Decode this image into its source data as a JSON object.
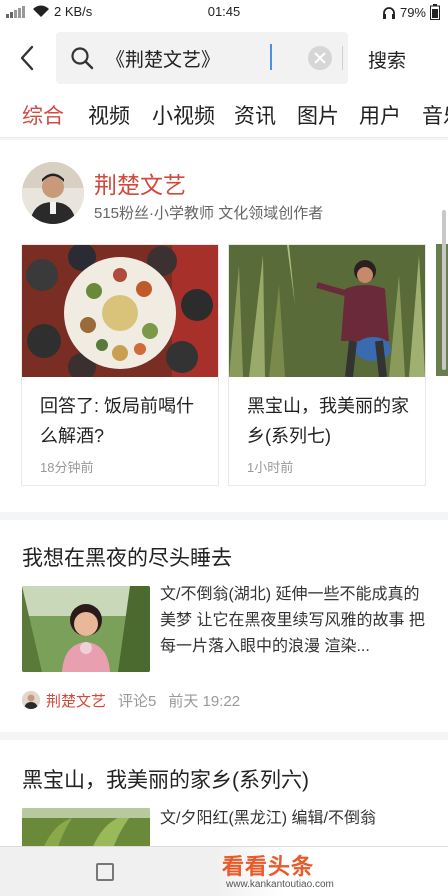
{
  "status": {
    "signal": "了了",
    "speed": "2 KB/s",
    "time": "01:45",
    "battery": "79%"
  },
  "search": {
    "query": "《荆楚文艺》",
    "button": "搜索"
  },
  "tabs": [
    {
      "label": "综合",
      "active": true
    },
    {
      "label": "视频",
      "active": false
    },
    {
      "label": "小视频",
      "active": false
    },
    {
      "label": "资讯",
      "active": false
    },
    {
      "label": "图片",
      "active": false
    },
    {
      "label": "用户",
      "active": false
    },
    {
      "label": "音乐",
      "active": false
    }
  ],
  "author_card": {
    "name": "荆楚文艺",
    "meta": "515粉丝·小学教师 文化领域创作者",
    "items": [
      {
        "title": "回答了: 饭局前喝什么解酒?",
        "time": "18分钟前"
      },
      {
        "title": "黑宝山，我美丽的家乡(系列七)",
        "time": "1小时前"
      }
    ]
  },
  "articles": [
    {
      "title": "我想在黑夜的尽头睡去",
      "excerpt": "文/不倒翁(湖北) 延伸一些不能成真的美梦 让它在黑夜里续写风雅的故事 把每一片落入眼中的浪漫 渲染...",
      "source": "荆楚文艺",
      "comments": "评论5",
      "time": "前天 19:22"
    },
    {
      "title": "黑宝山，我美丽的家乡(系列六)",
      "excerpt": "文/夕阳红(黑龙江) 编辑/不倒翁"
    }
  ],
  "watermark": {
    "text": "看看头条",
    "url": "www.kankantoutiao.com"
  },
  "colors": {
    "accent": "#d04a3e",
    "text": "#222222",
    "muted": "#999999"
  }
}
